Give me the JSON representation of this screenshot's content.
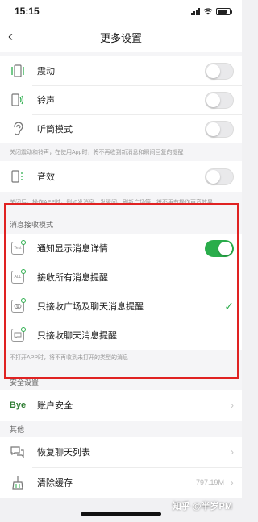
{
  "status": {
    "time": "15:15"
  },
  "nav": {
    "title": "更多设置"
  },
  "group1": {
    "rows": [
      {
        "label": "震动",
        "icon": "vibrate-icon",
        "toggle": false
      },
      {
        "label": "铃声",
        "icon": "ringtone-icon",
        "toggle": false
      },
      {
        "label": "听筒模式",
        "icon": "earpiece-icon",
        "toggle": false
      }
    ],
    "note": "关闭震动和铃声，在使用App时，将不再收到新消息和瞬间回复的提醒"
  },
  "group2": {
    "rows": [
      {
        "label": "音效",
        "icon": "sound-effect-icon",
        "toggle": false
      }
    ],
    "note": "关闭后，操作APP时，例如发消息、发瞬间、刷新广场等，将不再有操作声音效果"
  },
  "notify_mode": {
    "header": "消息接收模式",
    "rows": [
      {
        "label": "通知显示消息详情",
        "icon": "notify-detail-icon",
        "icon_text": "Text",
        "toggle": true
      },
      {
        "label": "接收所有消息提醒",
        "icon": "all-messages-icon",
        "icon_text": "ALL"
      },
      {
        "label": "只接收广场及聊天消息提醒",
        "icon": "square-chat-icon",
        "icon_text": "",
        "checked": true
      },
      {
        "label": "只接收聊天消息提醒",
        "icon": "chat-only-icon",
        "icon_text": ""
      }
    ],
    "note": "不打开APP时，将不再收到未打开的类型的消息"
  },
  "security": {
    "header": "安全设置",
    "rows": [
      {
        "label": "账户安全",
        "icon": "bye-logo-icon",
        "icon_text": "Bye"
      }
    ]
  },
  "other": {
    "header": "其他",
    "rows": [
      {
        "label": "恢复聊天列表",
        "icon": "restore-chat-icon"
      },
      {
        "label": "清除缓存",
        "icon": "clear-cache-icon",
        "value": "797.19M"
      }
    ]
  },
  "watermark": "知乎 @半岁PM",
  "colors": {
    "accent": "#2aad4b",
    "highlight_border": "#e02222"
  }
}
